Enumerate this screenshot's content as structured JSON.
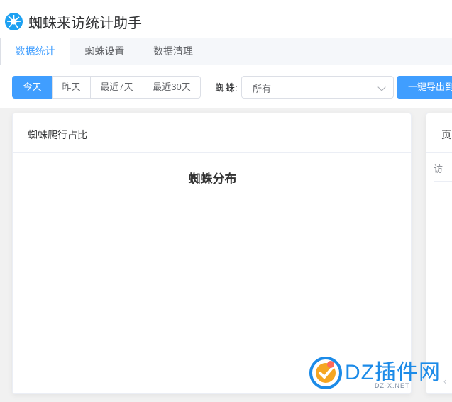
{
  "header": {
    "title": "蜘蛛来访统计助手"
  },
  "tabs": [
    {
      "label": "数据统计",
      "active": true
    },
    {
      "label": "蜘蛛设置"
    },
    {
      "label": "数据清理"
    }
  ],
  "date_range": {
    "options": [
      "今天",
      "昨天",
      "最近7天",
      "最近30天"
    ],
    "selected": "今天"
  },
  "spider_filter": {
    "label": "蜘蛛:",
    "value": "所有"
  },
  "export_button": {
    "label": "一键导出到"
  },
  "cards": {
    "left": {
      "title": "蜘蛛爬行占比",
      "chart_title": "蜘蛛分布"
    },
    "right": {
      "title": "页",
      "subtitle": "访"
    }
  },
  "watermark": {
    "brand": "DZ插件网",
    "url": "DZ-X.NET"
  },
  "colors": {
    "primary": "#409eff",
    "watermark": "#1c8be8"
  }
}
